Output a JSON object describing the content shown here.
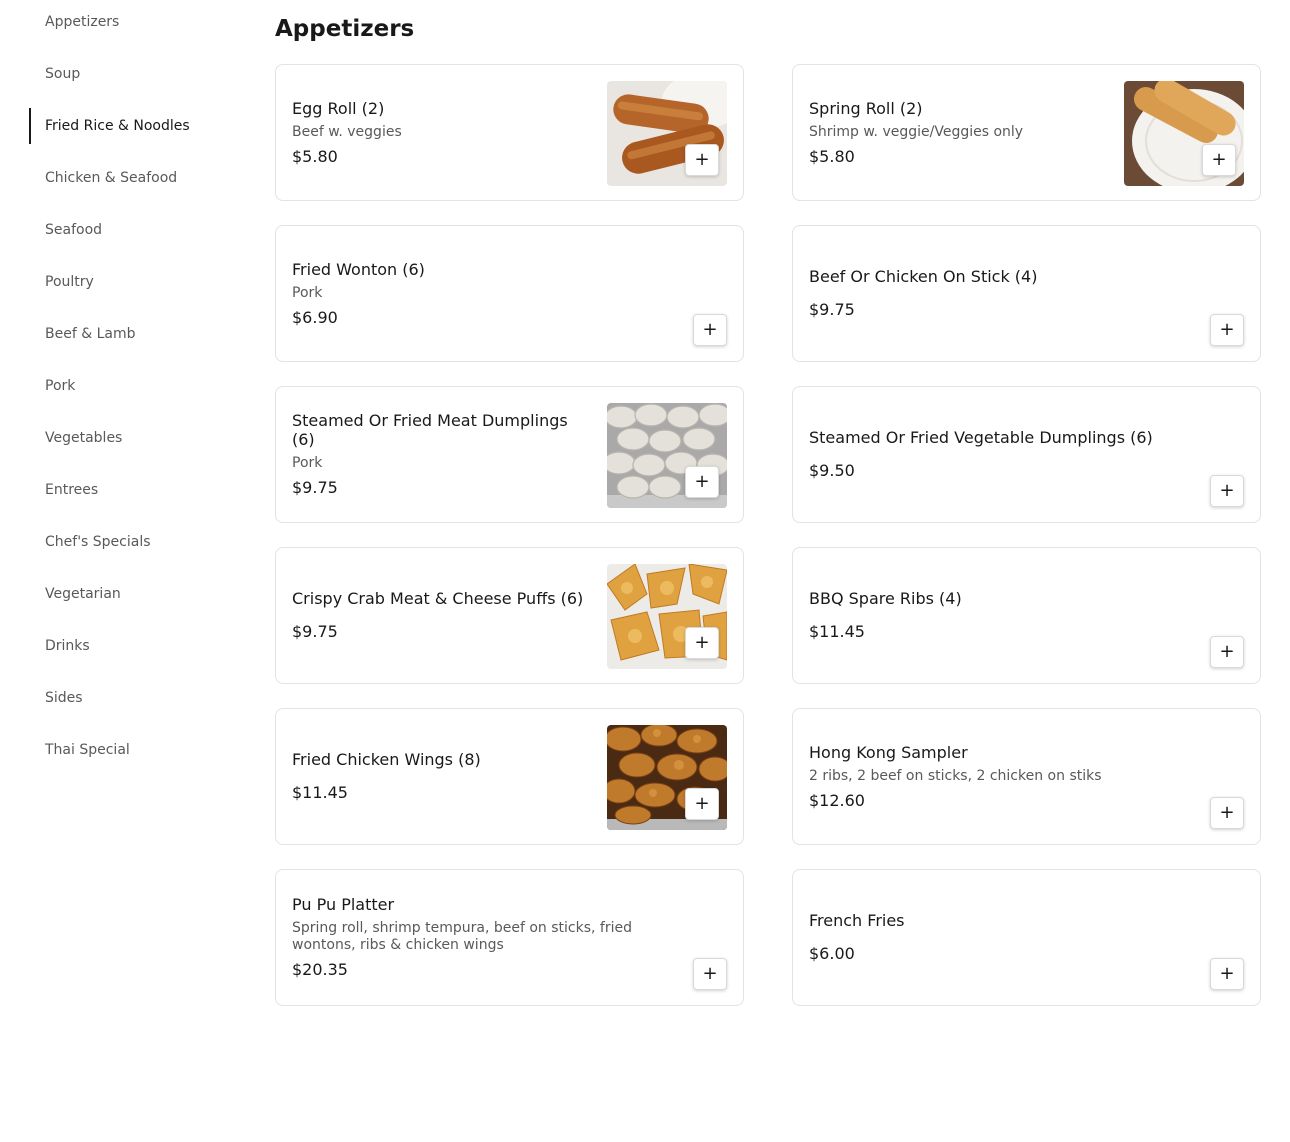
{
  "sidebar": {
    "items": [
      {
        "label": "Appetizers"
      },
      {
        "label": "Soup"
      },
      {
        "label": "Fried Rice & Noodles",
        "active": true
      },
      {
        "label": "Chicken & Seafood"
      },
      {
        "label": "Seafood"
      },
      {
        "label": "Poultry"
      },
      {
        "label": "Beef & Lamb"
      },
      {
        "label": "Pork"
      },
      {
        "label": "Vegetables"
      },
      {
        "label": "Entrees"
      },
      {
        "label": "Chef's Specials"
      },
      {
        "label": "Vegetarian"
      },
      {
        "label": "Drinks"
      },
      {
        "label": "Sides"
      },
      {
        "label": "Thai Special"
      }
    ]
  },
  "section": {
    "title": "Appetizers"
  },
  "add_icon": "plus-icon",
  "add_label": "+",
  "items": [
    {
      "name": "Egg Roll (2)",
      "description": "Beef w. veggies",
      "price": "$5.80",
      "image": "egg-roll-photo"
    },
    {
      "name": "Spring Roll (2)",
      "description": "Shrimp w. veggie/Veggies only",
      "price": "$5.80",
      "image": "spring-roll-photo"
    },
    {
      "name": "Fried Wonton (6)",
      "description": "Pork",
      "price": "$6.90",
      "image": null
    },
    {
      "name": "Beef Or Chicken On Stick (4)",
      "description": "",
      "price": "$9.75",
      "image": null
    },
    {
      "name": "Steamed Or Fried Meat Dumplings (6)",
      "description": "Pork",
      "price": "$9.75",
      "image": "dumplings-photo"
    },
    {
      "name": "Steamed Or Fried Vegetable Dumplings (6)",
      "description": "",
      "price": "$9.50",
      "image": null
    },
    {
      "name": "Crispy Crab Meat & Cheese Puffs (6)",
      "description": "",
      "price": "$9.75",
      "image": "crab-puffs-photo"
    },
    {
      "name": "BBQ Spare Ribs (4)",
      "description": "",
      "price": "$11.45",
      "image": null
    },
    {
      "name": "Fried Chicken Wings (8)",
      "description": "",
      "price": "$11.45",
      "image": "chicken-wings-photo"
    },
    {
      "name": "Hong Kong Sampler",
      "description": "2 ribs, 2 beef on sticks, 2 chicken on stiks",
      "price": "$12.60",
      "image": null
    },
    {
      "name": "Pu Pu Platter",
      "description": "Spring roll, shrimp tempura, beef on sticks, fried wontons, ribs & chicken wings",
      "price": "$20.35",
      "image": null
    },
    {
      "name": "French Fries",
      "description": "",
      "price": "$6.00",
      "image": null
    }
  ]
}
